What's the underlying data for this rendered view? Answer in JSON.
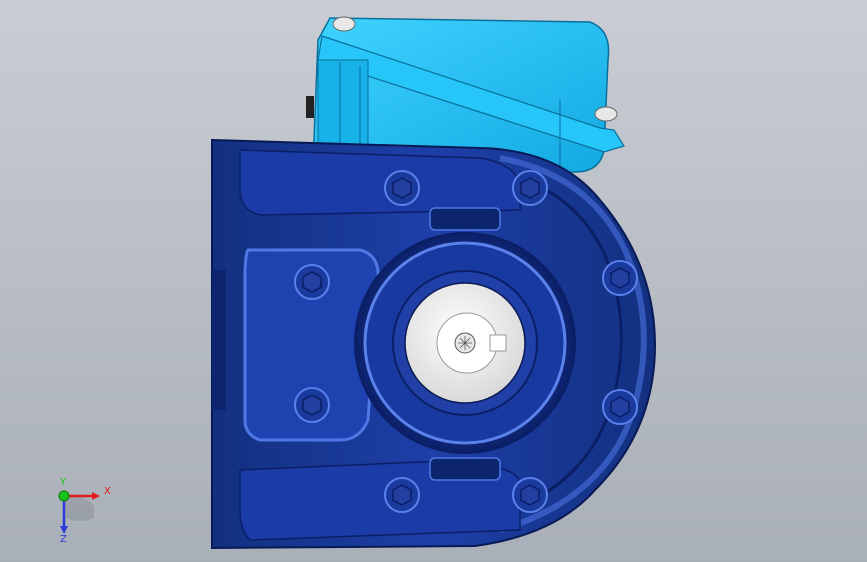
{
  "viewport": {
    "background_top": "#c9cdd3",
    "background_bottom": "#a9afb8"
  },
  "model": {
    "body_color": "#1a3a9e",
    "body_dark": "#0b1f66",
    "body_light": "#3a63d6",
    "motor_color": "#1ec3f7",
    "motor_dark": "#0a8fc7",
    "hub_color": "#f2f2f2"
  },
  "triad": {
    "x_label": "X",
    "y_label": "Y",
    "z_label": "Z",
    "x_color": "#e01c1c",
    "y_color": "#18c418",
    "z_color": "#2b3bd8"
  }
}
